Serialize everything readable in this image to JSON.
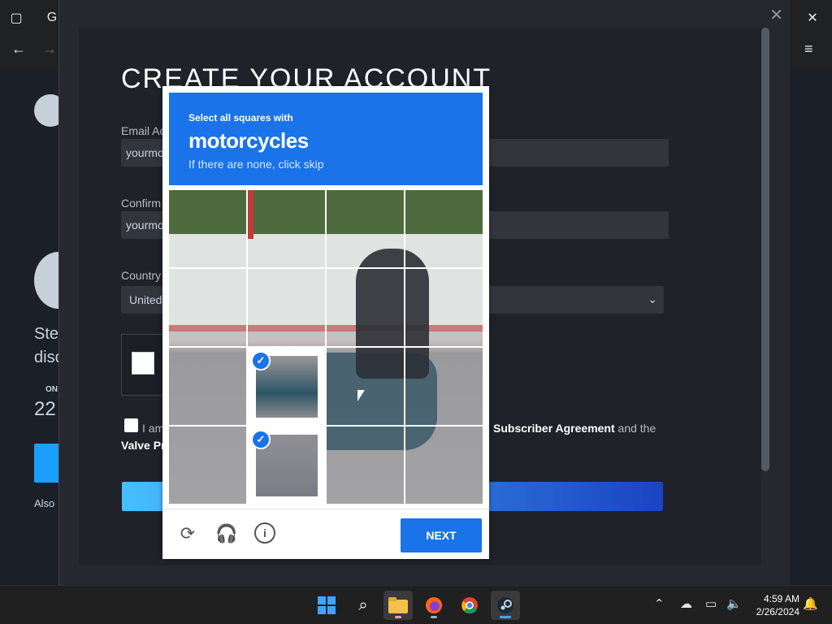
{
  "dialog": {
    "title": "CREATE YOUR ACCOUNT",
    "email_label": "Email Ac",
    "email_value": "yourmo",
    "confirm_label": "Confirm",
    "confirm_value": "yourmo",
    "country_label": "Country",
    "country_value": "United",
    "agree_prefix": "I am",
    "agree_link": "Subscriber Agreement",
    "agree_suffix": " and the",
    "valve_text": "Valve Pr",
    "close": "✕"
  },
  "background": {
    "steam_text_1": "Stea",
    "steam_text_2": "disc",
    "online_label": "ON",
    "count": "22",
    "also": "Also"
  },
  "captcha": {
    "prompt_pre": "Select all squares with",
    "target": "motorcycles",
    "prompt_sub": "If there are none, click skip",
    "next_label": "NEXT",
    "selected_tiles": [
      {
        "row": 3,
        "col": 2
      },
      {
        "row": 4,
        "col": 2
      }
    ]
  },
  "taskbar": {
    "time": "4:59 AM",
    "date": "2/26/2024"
  }
}
